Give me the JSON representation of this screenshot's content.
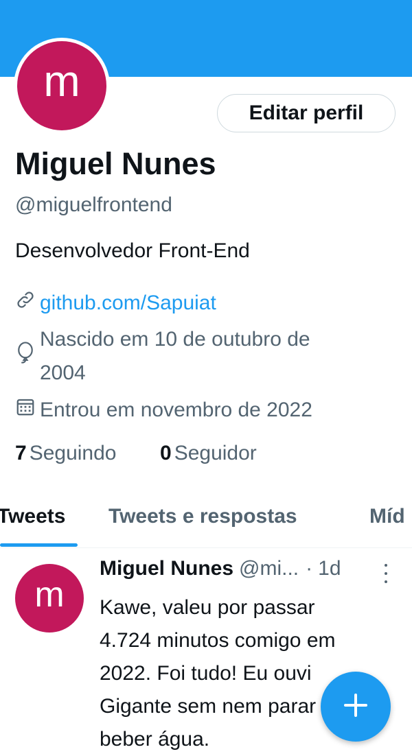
{
  "profile": {
    "avatar_letter": "m",
    "edit_button": "Editar perfil",
    "name": "Miguel Nunes",
    "handle": "@miguelfrontend",
    "bio": "Desenvolvedor Front-End",
    "link": "github.com/Sapuiat",
    "birth_line1": "Nascido em 10 de outubro de",
    "birth_line2": "2004",
    "joined": "Entrou em novembro de 2022",
    "following_count": "7",
    "following_label": "Seguindo",
    "followers_count": "0",
    "followers_label": "Seguidor"
  },
  "tabs": [
    {
      "label": "Tweets",
      "active": true
    },
    {
      "label": "Tweets e respostas",
      "active": false
    },
    {
      "label": "Míd",
      "active": false
    }
  ],
  "tweet": {
    "avatar_letter": "m",
    "name": "Miguel Nunes",
    "handle": "@mi...",
    "separator": "·",
    "time": "1d",
    "lines": [
      "Kawe, valeu por passar",
      "4.724 minutos comigo em",
      "2022. Foi tudo! Eu ouvi",
      "Gigante sem nem parar",
      "beber água."
    ]
  },
  "colors": {
    "accent": "#1d9bf0",
    "avatar": "#c2185b",
    "secondary_text": "#536471"
  },
  "icons": [
    "link-icon",
    "balloon-icon",
    "calendar-icon",
    "more-icon",
    "compose-plus-icon"
  ]
}
